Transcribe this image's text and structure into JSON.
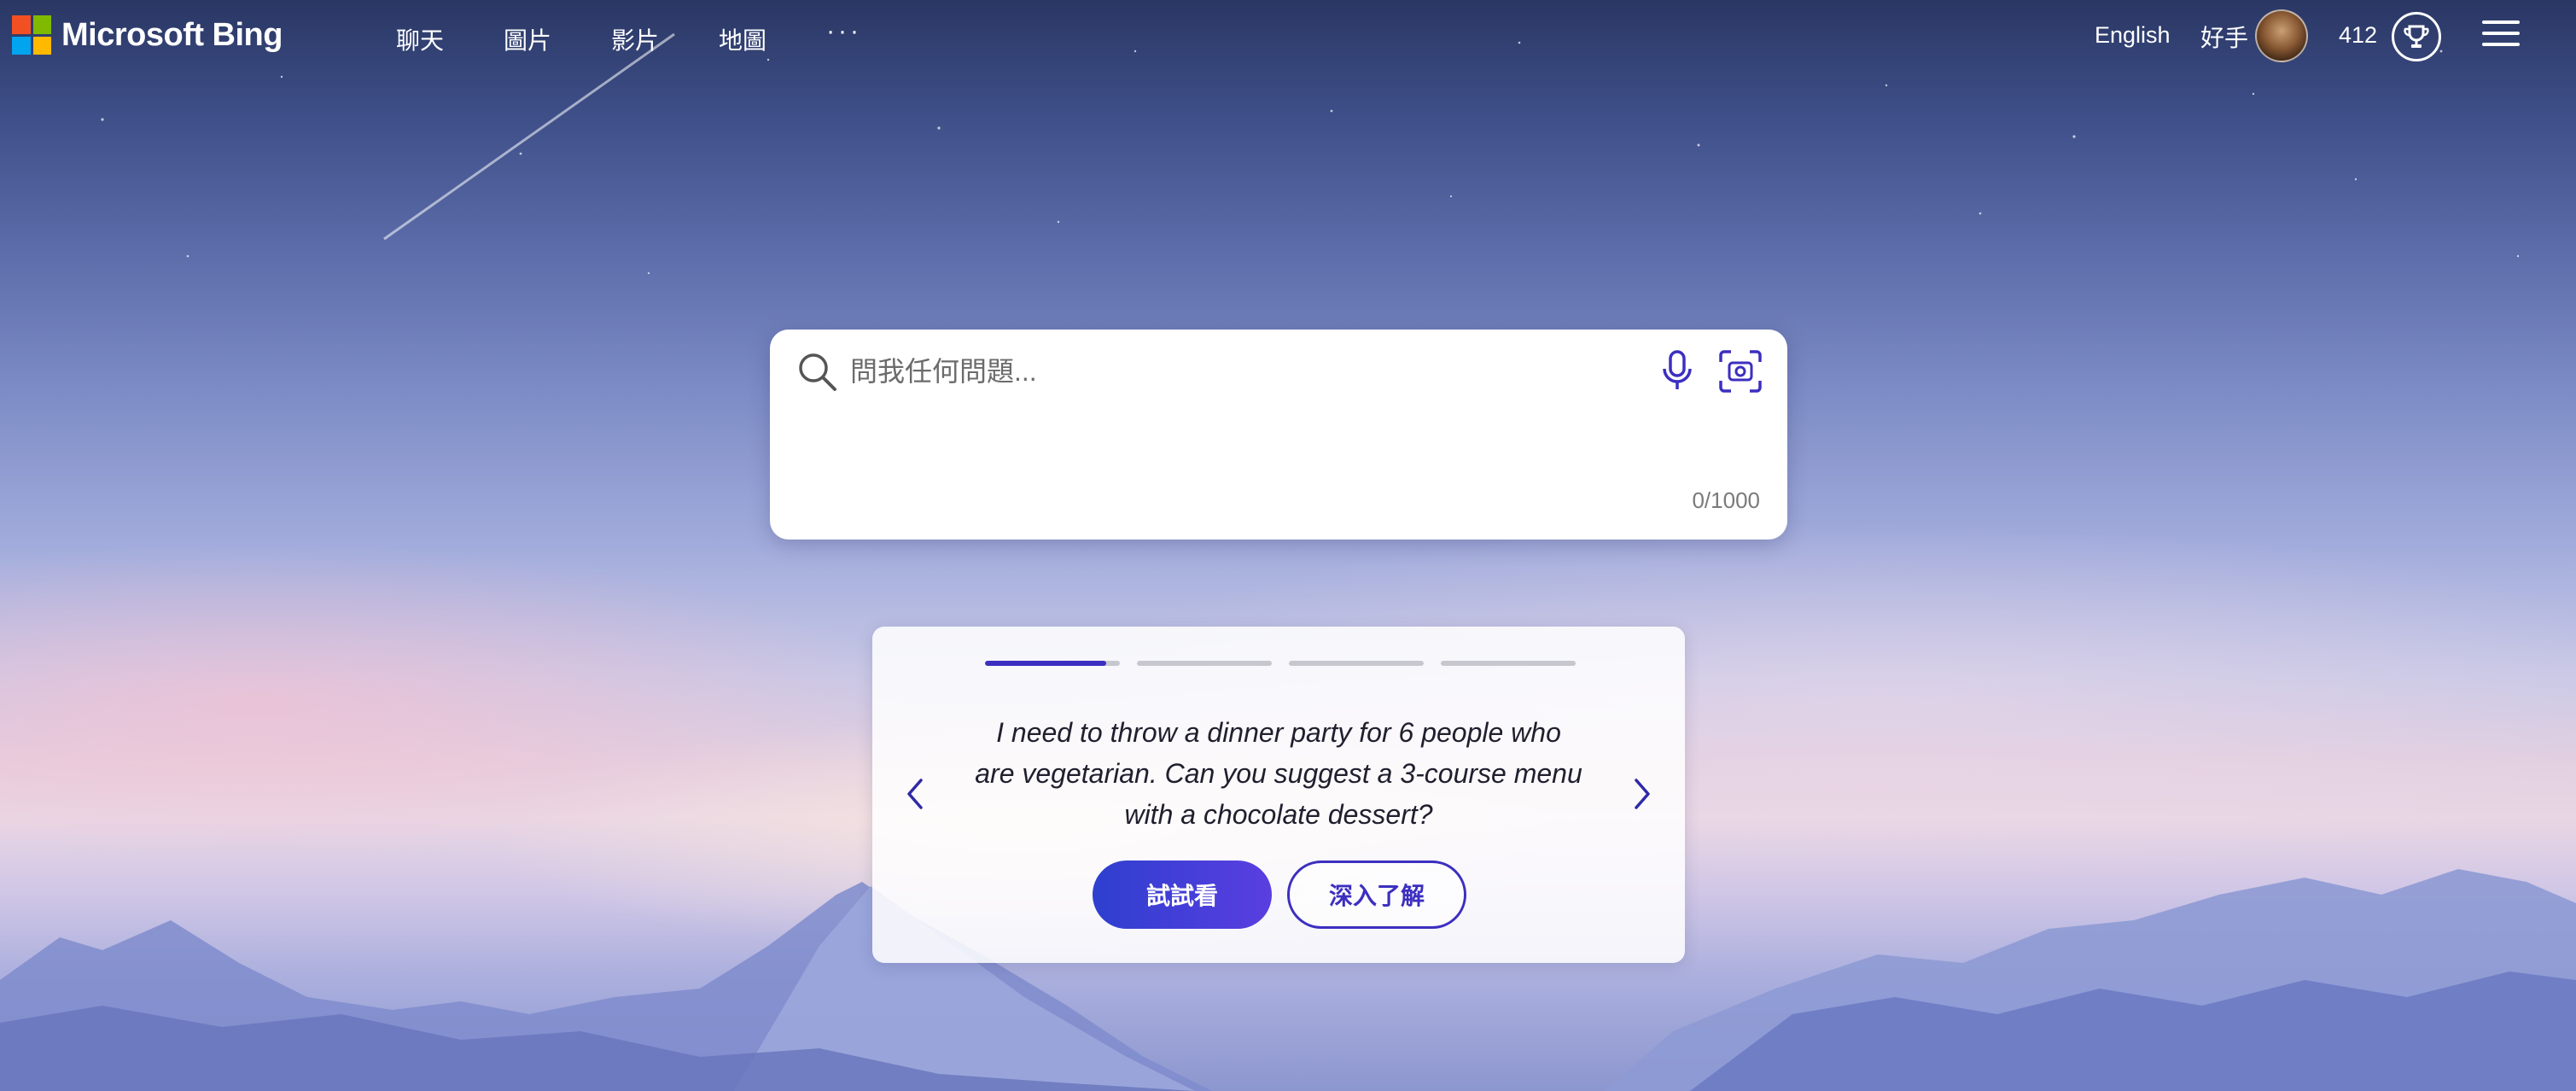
{
  "header": {
    "brand": "Microsoft Bing",
    "logo_colors": [
      "#f25022",
      "#7fba00",
      "#00a4ef",
      "#ffb900"
    ],
    "nav": [
      {
        "label": "聊天"
      },
      {
        "label": "圖片"
      },
      {
        "label": "影片"
      },
      {
        "label": "地圖"
      }
    ],
    "more_label": "···",
    "language": "English",
    "user_name": "好手",
    "points": "412",
    "rewards_icon": "trophy-icon",
    "menu_icon": "hamburger-icon"
  },
  "search": {
    "placeholder": "問我任何問題...",
    "value": "",
    "char_count": "0/1000",
    "icons": [
      "search-icon",
      "microphone-icon",
      "visual-search-icon"
    ]
  },
  "prompt_card": {
    "progress": {
      "segments": 4,
      "active_index": 0,
      "active_fraction": 0.9
    },
    "text": "I need to throw a dinner party for 6 people who are vegetarian. Can you suggest a 3-course menu with a chocolate dessert?",
    "try_label": "試試看",
    "learn_label": "深入了解"
  },
  "colors": {
    "accent": "#3c2fc0",
    "card_bg": "#ffffff"
  }
}
